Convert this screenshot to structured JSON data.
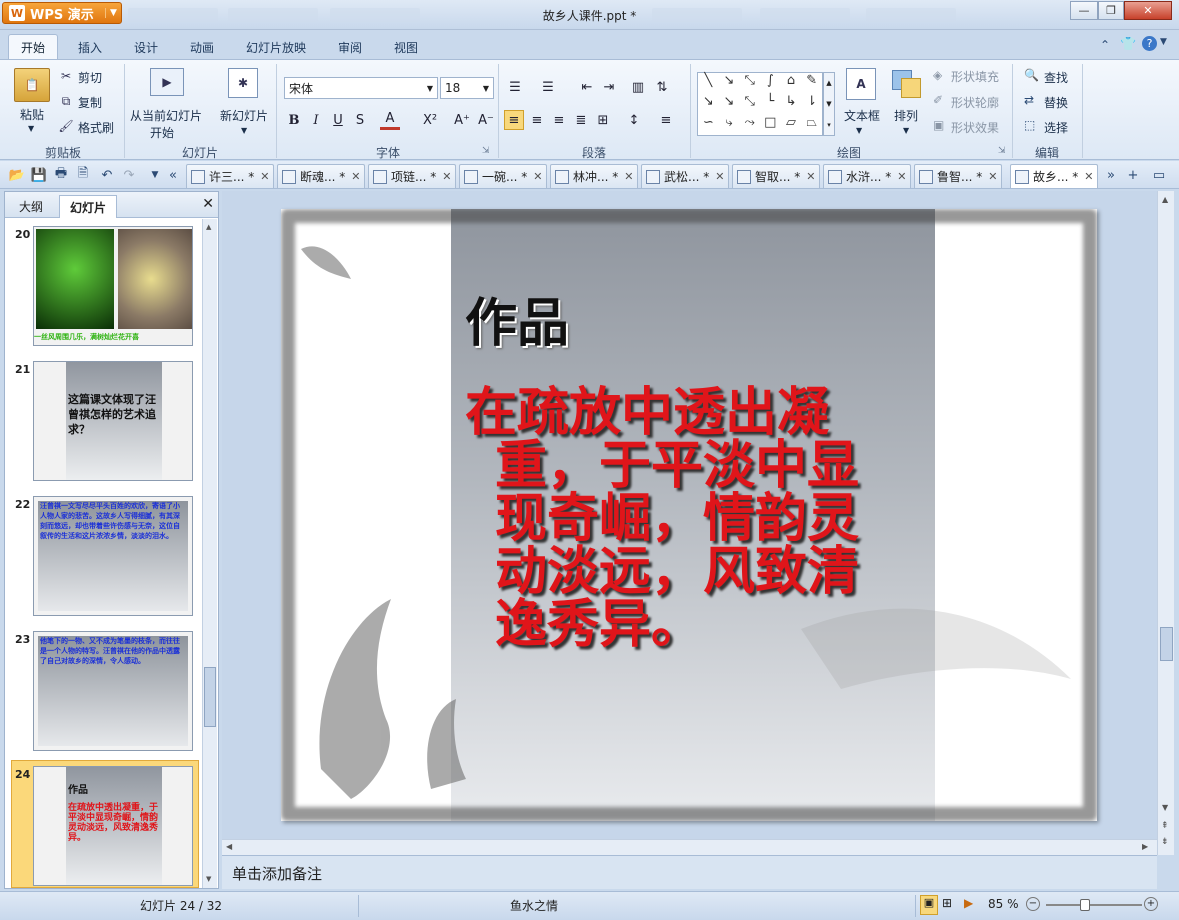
{
  "app": {
    "brand": "WPS 演示",
    "doc_title": "故乡人课件.ppt *"
  },
  "ribbon_tabs": [
    "开始",
    "插入",
    "设计",
    "动画",
    "幻灯片放映",
    "审阅",
    "视图"
  ],
  "clipboard": {
    "paste": "粘贴",
    "cut": "剪切",
    "copy": "复制",
    "format_painter": "格式刷",
    "group": "剪贴板"
  },
  "slides_group": {
    "from_current_1": "从当前幻灯片",
    "from_current_2": "开始",
    "new_slide": "新幻灯片",
    "group": "幻灯片"
  },
  "font": {
    "name": "宋体",
    "size": "18",
    "group": "字体",
    "bold": "B",
    "italic": "I",
    "underline": "U",
    "shadow": "S",
    "color": "A",
    "superscript": "X²",
    "grow": "A⁺",
    "shrink": "A⁻"
  },
  "paragraph": {
    "group": "段落"
  },
  "drawing": {
    "textbox": "文本框",
    "arrange": "排列",
    "shape_fill": "形状填充",
    "shape_outline": "形状轮廓",
    "shape_effect": "形状效果",
    "group": "绘图"
  },
  "editing": {
    "find": "查找",
    "replace": "替换",
    "select": "选择",
    "group": "编辑"
  },
  "doc_tabs": [
    "许三... *",
    "断魂... *",
    "项链... *",
    "一碗... *",
    "林冲... *",
    "武松... *",
    "智取... *",
    "水浒... *",
    "鲁智... *",
    "故乡... *"
  ],
  "pane": {
    "outline_tab": "大纲",
    "slides_tab": "幻灯片",
    "close": "✕"
  },
  "thumbnails": [
    {
      "num": "20",
      "caption": "一丝风周围几乐，满树灿烂花开喜"
    },
    {
      "num": "21",
      "text": "这篇课文体现了汪曾祺怎样的艺术追求？"
    },
    {
      "num": "22",
      "text": "汪曾祺一文写尽尽平头百姓的欢欣，寄语了小人物人家的悲苦。这故乡人写得细腻，有其深刻而悠远，却也带着些许伤感与无奈，这位自叙传的生活和这片浓浓乡情，淡淡的泪水。"
    },
    {
      "num": "23",
      "text": "他笔下的一物、又不成为笔墨的枝条，而往往是一个人物的特写。汪曾祺在他的作品中透露了自己对故乡的深情，令人感动。"
    },
    {
      "num": "24",
      "title": "作品",
      "text": "在疏放中透出凝重，于平淡中显现奇崛，情韵灵动淡远，风致清逸秀异。"
    }
  ],
  "slide": {
    "title": "作品",
    "body": "在疏放中透出凝重，于平淡中显现奇崛，情韵灵动淡远，风致清逸秀异。"
  },
  "notes_placeholder": "单击添加备注",
  "status": {
    "slide_counter": "幻灯片 24 / 32",
    "theme": "鱼水之情",
    "zoom": "85 %"
  }
}
